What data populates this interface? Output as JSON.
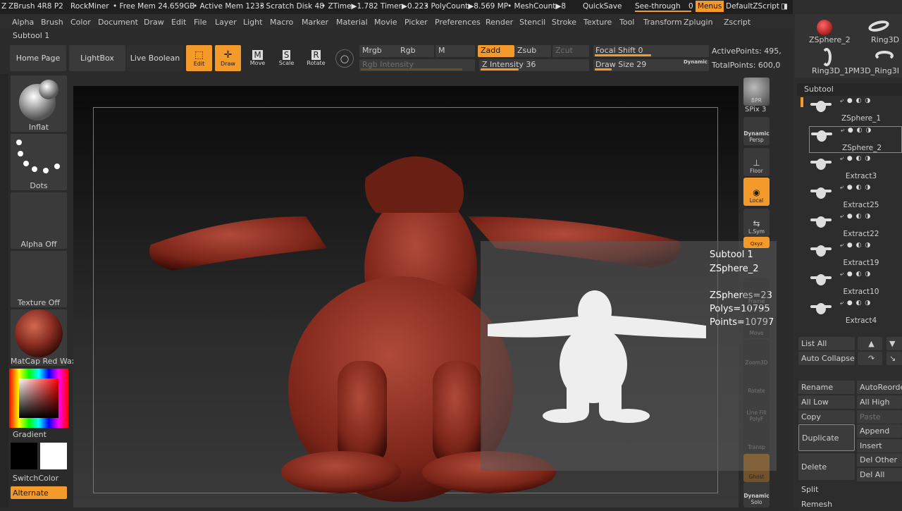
{
  "titlebar": {
    "app": "ZBrush 4R8 P2",
    "user": "RockMiner",
    "free_mem": "• Free Mem 24.659GB",
    "active_mem": "• Active Mem 1233",
    "scratch": "• Scratch Disk 48",
    "ztime": "• ZTime▶1.782 Timer▶0.223",
    "polycount": "• PolyCount▶8.569 MP",
    "meshcount": "• MeshCount▶8",
    "quicksave": "QuickSave",
    "seethrough": "See-through",
    "seethrough_val": "0",
    "menus": "Menus",
    "defaultzscript": "DefaultZScript"
  },
  "menubar": [
    "Alpha",
    "Brush",
    "Color",
    "Document",
    "Draw",
    "Edit",
    "File",
    "Layer",
    "Light",
    "Macro",
    "Marker",
    "Material",
    "Movie",
    "Picker",
    "Preferences",
    "Render",
    "Stencil",
    "Stroke",
    "Texture",
    "Tool",
    "Transform",
    "Zplugin",
    "Zscript"
  ],
  "subtool_label": "Subtool 1",
  "shelf": {
    "home_page": "Home Page",
    "lightbox": "LightBox",
    "live_boolean": "Live Boolean",
    "edit": "Edit",
    "draw": "Draw",
    "move": "Move",
    "scale": "Scale",
    "rotate": "Rotate",
    "mrgb": "Mrgb",
    "rgb": "Rgb",
    "m": "M",
    "zadd": "Zadd",
    "zsub": "Zsub",
    "zcut": "Zcut",
    "rgb_intensity": "Rgb Intensity",
    "z_intensity": "Z Intensity 36",
    "focal_shift": "Focal Shift 0",
    "draw_size": "Draw Size 29",
    "dynamic": "Dynamic",
    "active_points": "ActivePoints: 495,",
    "total_points": "TotalPoints: 600,0"
  },
  "values": {
    "z_intensity": 0.36,
    "focal_shift": 0.5,
    "draw_size": 0.15,
    "rgb_intensity": 0.9
  },
  "left": {
    "brush": "Inflat",
    "stroke": "Dots",
    "alpha": "Alpha Off",
    "texture": "Texture Off",
    "material": "MatCap Red Wax",
    "gradient": "Gradient",
    "switchcolor": "SwitchColor",
    "alternate": "Alternate"
  },
  "right_tools": {
    "bpr": "BPR",
    "spix": "SPix 3",
    "dynamic": "Dynamic",
    "persp": "Persp",
    "floor": "Floor",
    "local": "Local",
    "lsym": "L.Sym",
    "xyz": "Qxyz",
    "frame": "Frame",
    "move": "Move",
    "zoom3d": "Zoom3D",
    "rotate": "Rotate",
    "line_fill": "Line Fill",
    "polyf": "PolyF",
    "transp": "Transp",
    "ghost": "Ghost",
    "dynamic2": "Dynamic",
    "solo": "Solo"
  },
  "popup": {
    "subtool": "Subtool 1",
    "name": "ZSphere_2",
    "zspheres": "ZSpheres=23",
    "polys": "Polys=10795",
    "points": "Points=10797"
  },
  "tool_thumbs": {
    "zsphere2": "ZSphere_2",
    "ring3d": "Ring3D",
    "ring3d_1": "Ring3D_1",
    "pm3d_ring": "PM3D_Ring3I"
  },
  "subtool_panel": {
    "title": "Subtool",
    "items": [
      "ZSphere_1",
      "ZSphere_2",
      "Extract3",
      "Extract25",
      "Extract22",
      "Extract19",
      "Extract10",
      "Extract4"
    ],
    "ctrl_glyphs": "⤶ ● ◐ ◑"
  },
  "subtool_buttons": {
    "list_all": "List All",
    "auto_collapse": "Auto Collapse",
    "rename": "Rename",
    "autoreorder": "AutoReorder",
    "all_low": "All Low",
    "all_high": "All High",
    "copy": "Copy",
    "paste": "Paste",
    "duplicate": "Duplicate",
    "append": "Append",
    "insert": "Insert",
    "delete": "Delete",
    "del_other": "Del Other",
    "del_all": "Del All",
    "split": "Split",
    "remesh": "Remesh"
  },
  "colors": {
    "accent": "#f39a2a",
    "model": "#8a2d22",
    "bg": "#2b2b2b"
  }
}
